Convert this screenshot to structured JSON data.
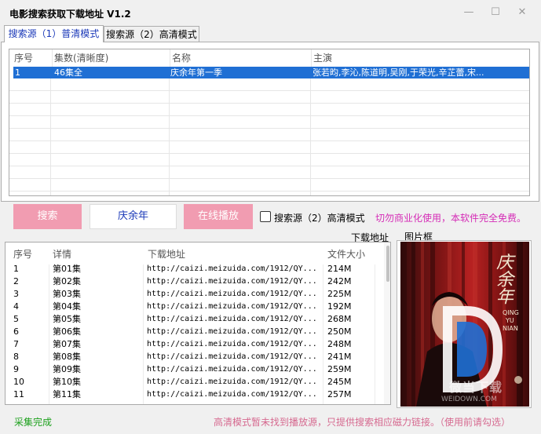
{
  "window": {
    "title": "电影搜索获取下载地址 V1.2",
    "min_glyph": "—",
    "max_glyph": "☐",
    "close_glyph": "✕"
  },
  "tabs": [
    {
      "label": "搜索源（1）普清模式",
      "active": true
    },
    {
      "label": "搜索源（2）高清模式",
      "active": false
    }
  ],
  "results_table": {
    "columns": [
      "序号",
      "集数(清晰度)",
      "名称",
      "主演"
    ],
    "rows": [
      {
        "index": "1",
        "episodes": "46集全",
        "name": "庆余年第一季",
        "cast": "张若昀,李沁,陈道明,吴刚,于荣光,辛芷蕾,宋..."
      }
    ]
  },
  "controls": {
    "search_button": "搜索",
    "search_value": "庆余年",
    "play_button": "在线播放",
    "hd_checkbox_label": "搜索源（2）高清模式",
    "hd_checked": false,
    "warning": "切勿商业化使用，本软件完全免费。"
  },
  "labels": {
    "download_address": "下载地址",
    "picture_frame": "图片框"
  },
  "downloads_table": {
    "columns": [
      "序号",
      "详情",
      "下载地址",
      "文件大小"
    ],
    "rows": [
      {
        "index": "1",
        "detail": "第01集",
        "url": "http://caizi.meizuida.com/1912/QY...",
        "size": "214M"
      },
      {
        "index": "2",
        "detail": "第02集",
        "url": "http://caizi.meizuida.com/1912/QY...",
        "size": "242M"
      },
      {
        "index": "3",
        "detail": "第03集",
        "url": "http://caizi.meizuida.com/1912/QY...",
        "size": "225M"
      },
      {
        "index": "4",
        "detail": "第04集",
        "url": "http://caizi.meizuida.com/1912/QY...",
        "size": "192M"
      },
      {
        "index": "5",
        "detail": "第05集",
        "url": "http://caizi.meizuida.com/1912/QY...",
        "size": "268M"
      },
      {
        "index": "6",
        "detail": "第06集",
        "url": "http://caizi.meizuida.com/1912/QY...",
        "size": "250M"
      },
      {
        "index": "7",
        "detail": "第07集",
        "url": "http://caizi.meizuida.com/1912/QY...",
        "size": "248M"
      },
      {
        "index": "8",
        "detail": "第08集",
        "url": "http://caizi.meizuida.com/1912/QY...",
        "size": "241M"
      },
      {
        "index": "9",
        "detail": "第09集",
        "url": "http://caizi.meizuida.com/1912/QY...",
        "size": "259M"
      },
      {
        "index": "10",
        "detail": "第10集",
        "url": "http://caizi.meizuida.com/1912/QY...",
        "size": "245M"
      },
      {
        "index": "11",
        "detail": "第11集",
        "url": "http://caizi.meizuida.com/1912/QY...",
        "size": "257M"
      }
    ]
  },
  "poster": {
    "title_cn": "庆余年",
    "title_pin_1": "QING",
    "title_pin_2": "YU",
    "title_pin_3": "NIAN",
    "watermark": "WEIDOWN.COM",
    "watermark_cn": "微当下载"
  },
  "status": {
    "left": "采集完成",
    "note": "高清模式暂未找到播放源，只提供搜索相应磁力链接。（使用前请勾选）"
  },
  "colors": {
    "selection": "#1f6fd4",
    "pink_button": "#f19cb1",
    "warning": "#d52bb6",
    "status_ok": "#1ea11e",
    "note": "#d66a90"
  }
}
